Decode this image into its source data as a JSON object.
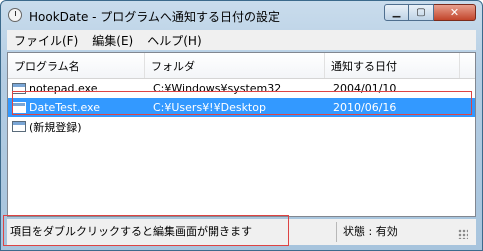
{
  "window": {
    "title": "HookDate - プログラムへ通知する日付の設定",
    "buttons": {
      "minimize": "▁",
      "maximize": "▢",
      "close": "✕"
    }
  },
  "menu": [
    "ファイル(F)",
    "編集(E)",
    "ヘルプ(H)"
  ],
  "table": {
    "columns": [
      "プログラム名",
      "フォルダ",
      "通知する日付"
    ],
    "rows": [
      {
        "name": "notepad.exe",
        "folder": "C:¥Windows¥system32",
        "date": "2004/01/10",
        "selected": false
      },
      {
        "name": "DateTest.exe",
        "folder": "C:¥Users¥!¥Desktop",
        "date": "2010/06/16",
        "selected": true
      },
      {
        "name": "(新規登録)",
        "folder": "",
        "date": "",
        "selected": false
      }
    ]
  },
  "status": {
    "hint": "項目をダブルクリックすると編集画面が開きます",
    "state": "状態 : 有効"
  }
}
